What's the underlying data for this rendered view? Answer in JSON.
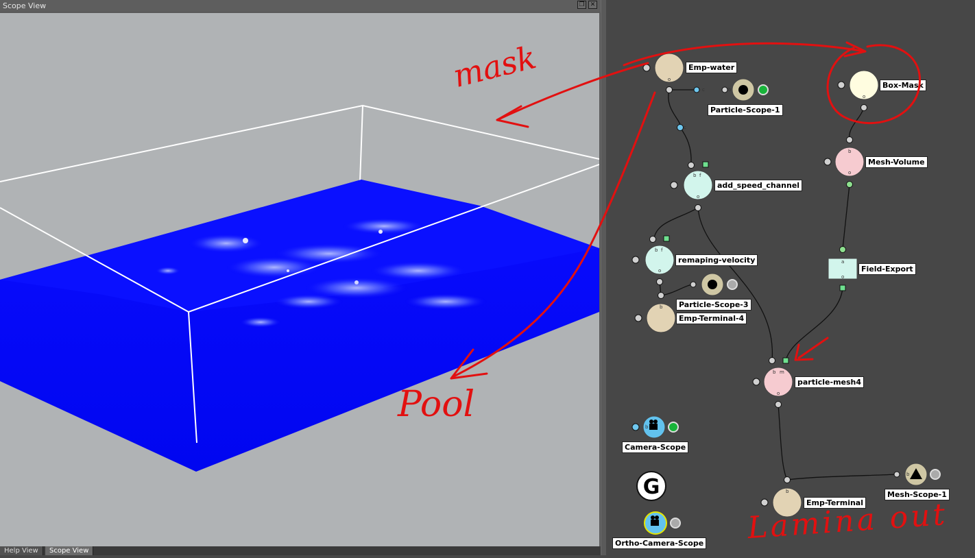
{
  "scope_view": {
    "title": "Scope View",
    "buttons": {
      "float_icon": "float-window-icon",
      "close_icon": "close-icon"
    },
    "colors": {
      "background": "#b0b3b5",
      "water": "#0008ff",
      "box_outline": "#ffffff"
    }
  },
  "tabs": [
    {
      "label": "Help View",
      "active": false
    },
    {
      "label": "Scope View",
      "active": true
    }
  ],
  "node_graph": {
    "nodes": [
      {
        "id": "emp-water",
        "label": "Emp-water",
        "color": "#e2d3b4"
      },
      {
        "id": "particle-scope-1",
        "label": "Particle-Scope-1",
        "color": "#cfc7a4"
      },
      {
        "id": "box-mask",
        "label": "Box-Mask",
        "color": "#fffde0"
      },
      {
        "id": "mesh-volume",
        "label": "Mesh-Volume",
        "color": "#f6cbd0"
      },
      {
        "id": "add-speed-channel",
        "label": "add_speed_channel",
        "color": "#d2f5ec"
      },
      {
        "id": "remaping-velocity",
        "label": "remaping-velocity",
        "color": "#d2f5ec"
      },
      {
        "id": "field-export",
        "label": "Field-Export",
        "color": "#d2f5ec"
      },
      {
        "id": "particle-scope-3",
        "label": "Particle-Scope-3",
        "color": "#cfc7a4"
      },
      {
        "id": "emp-terminal-4",
        "label": "Emp-Terminal-4",
        "color": "#e2d3b4"
      },
      {
        "id": "particle-mesh4",
        "label": "particle-mesh4",
        "color": "#f6cbd0"
      },
      {
        "id": "camera-scope",
        "label": "Camera-Scope",
        "color": "#62c2ee"
      },
      {
        "id": "emp-terminal",
        "label": "Emp-Terminal",
        "color": "#e2d3b4"
      },
      {
        "id": "mesh-scope-1",
        "label": "Mesh-Scope-1",
        "color": "#cfc7a4"
      },
      {
        "id": "ortho-camera-scope",
        "label": "Ortho-Camera-Scope",
        "color": "#62c2ee"
      }
    ],
    "global_node_glyph": "G",
    "port_letters": {
      "o": "o",
      "c": "c",
      "b": "b",
      "f": "f",
      "a": "a",
      "m": "m"
    }
  },
  "annotations": {
    "mask": "mask",
    "pool": "Pool",
    "lamina_out": "Lamina  out",
    "color": "#e21010"
  }
}
